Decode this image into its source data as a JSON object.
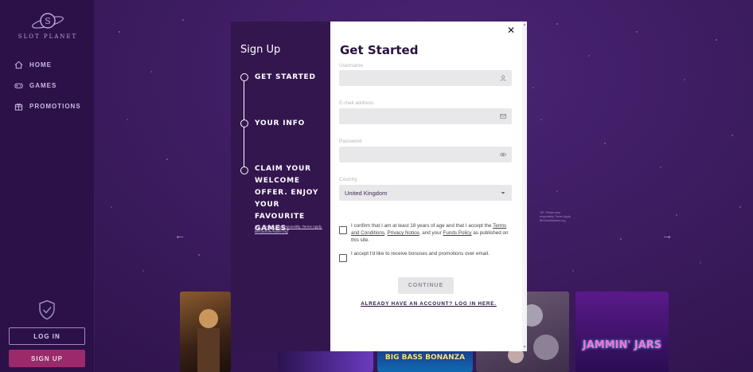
{
  "brand": {
    "name": "SLOT PLANET"
  },
  "sidebar": {
    "items": [
      {
        "label": "HOME",
        "icon": "home-icon"
      },
      {
        "label": "GAMES",
        "icon": "gamepad-icon"
      },
      {
        "label": "PROMOTIONS",
        "icon": "gift-icon"
      }
    ],
    "login_label": "LOG IN",
    "signup_label": "SIGN UP"
  },
  "stepper": {
    "title": "Sign Up",
    "steps": [
      {
        "label": "GET STARTED"
      },
      {
        "label": "YOUR INFO"
      },
      {
        "label": "CLAIM YOUR WELCOME OFFER. ENJOY YOUR FAVOURITE GAMES."
      }
    ],
    "fine_print": "18+. Please play responsibly. Terms Apply. BeGambleAware.org"
  },
  "modal": {
    "title": "Get Started",
    "username_label": "Username",
    "email_label": "E-mail address",
    "password_label": "Password",
    "country_label": "Country",
    "country_value": "United Kingdom",
    "terms_prefix": "I confirm that I am at least 18 years of age and that I accept the ",
    "terms_link": "Terms and Conditions",
    "terms_sep": ", ",
    "privacy_link": "Privacy Notice",
    "terms_mid": ", and your ",
    "funds_link": "Funds Policy",
    "terms_suffix": " as published on this site.",
    "bonus_text": "I accept I'd like to receive bonuses and promotions over email.",
    "continue_label": "CONTINUE",
    "login_link": "ALREADY HAVE AN ACCOUNT? LOG IN HERE.",
    "close_glyph": "✕"
  },
  "carousel": {
    "prev_glyph": "←",
    "next_glyph": "→",
    "side_note": "18+. Please play responsibly. Terms Apply. BeGambleAware.org"
  },
  "games": [
    {
      "title": ""
    },
    {
      "title": ""
    },
    {
      "title": "BIG BASS BONANZA"
    },
    {
      "title": ""
    },
    {
      "title": "JAMMIN' JARS"
    }
  ],
  "colors": {
    "background": "#3a1a5c",
    "sidebar": "#2b1147",
    "signup_accent": "#9b2a6a",
    "modal": "#ffffff",
    "title": "#2a1240"
  }
}
